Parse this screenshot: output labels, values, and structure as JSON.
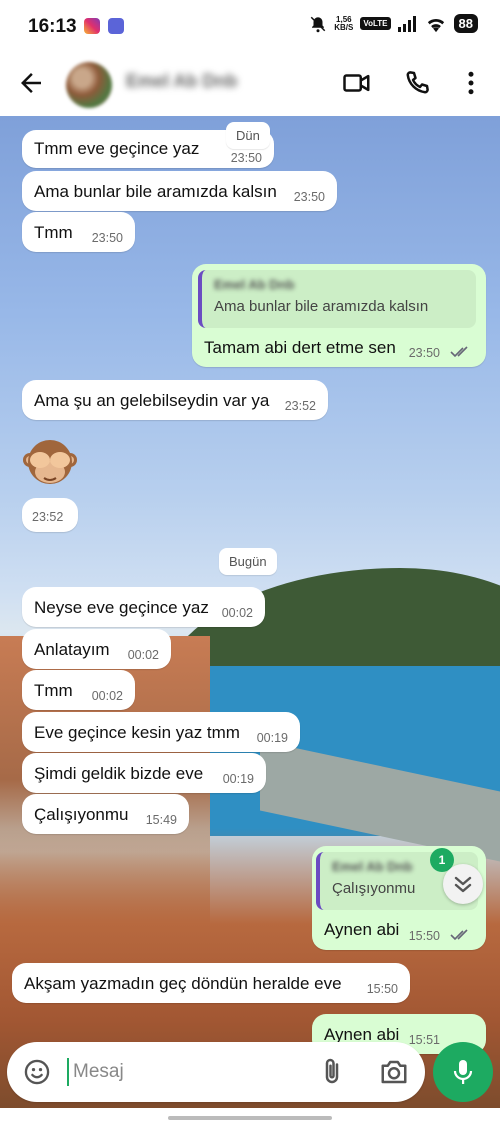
{
  "status_bar": {
    "time": "16:13",
    "net_speed_value": "1,56",
    "net_speed_unit": "KB/S",
    "volte": "VoLTE",
    "battery": "88"
  },
  "header": {
    "contact_name": "Emel Ab Dnb"
  },
  "chat": {
    "date_yesterday": "Dün",
    "date_today": "Bugün",
    "messages": [
      {
        "text": "Tmm eve geçince yaz",
        "time": "23:50"
      },
      {
        "text": "Ama bunlar bile aramızda kalsın",
        "time": "23:50"
      },
      {
        "text": "Tmm",
        "time": "23:50"
      },
      {
        "quote_name": "Emel Ab Dnb",
        "quote_text": "Ama bunlar bile aramızda kalsın",
        "text": "Tamam abi dert etme sen",
        "time": "23:50"
      },
      {
        "text": "Ama şu an gelebilseydin var ya",
        "time": "23:52"
      },
      {
        "emoji": "🙈",
        "time": "23:52"
      },
      {
        "text": "Neyse eve geçince yaz",
        "time": "00:02"
      },
      {
        "text": "Anlatayım",
        "time": "00:02"
      },
      {
        "text": "Tmm",
        "time": "00:02"
      },
      {
        "text": "Eve geçince kesin yaz tmm",
        "time": "00:19"
      },
      {
        "text": "Şimdi geldik bizde eve",
        "time": "00:19"
      },
      {
        "text": "Çalışıyonmu",
        "time": "15:49"
      },
      {
        "quote_name": "Emel Ab Dnb",
        "quote_text": "Çalışıyonmu",
        "text": "Aynen abi",
        "time": "15:50"
      },
      {
        "text": "Akşam yazmadın geç döndün heralde eve",
        "time": "15:50"
      },
      {
        "text": "Aynen abi",
        "time": "15:51"
      }
    ],
    "unread_count": "1"
  },
  "input": {
    "placeholder": "Mesaj"
  },
  "colors": {
    "accent": "#1daa61",
    "outgoing_bubble": "#d9fdd3",
    "incoming_bubble": "#ffffff",
    "quote_bar": "#6b4cc2"
  },
  "icons": [
    "back-arrow-icon",
    "video-call-icon",
    "phone-icon",
    "more-options-icon",
    "emoji-icon",
    "attach-icon",
    "camera-icon",
    "mic-icon",
    "chevron-down-double-icon"
  ]
}
